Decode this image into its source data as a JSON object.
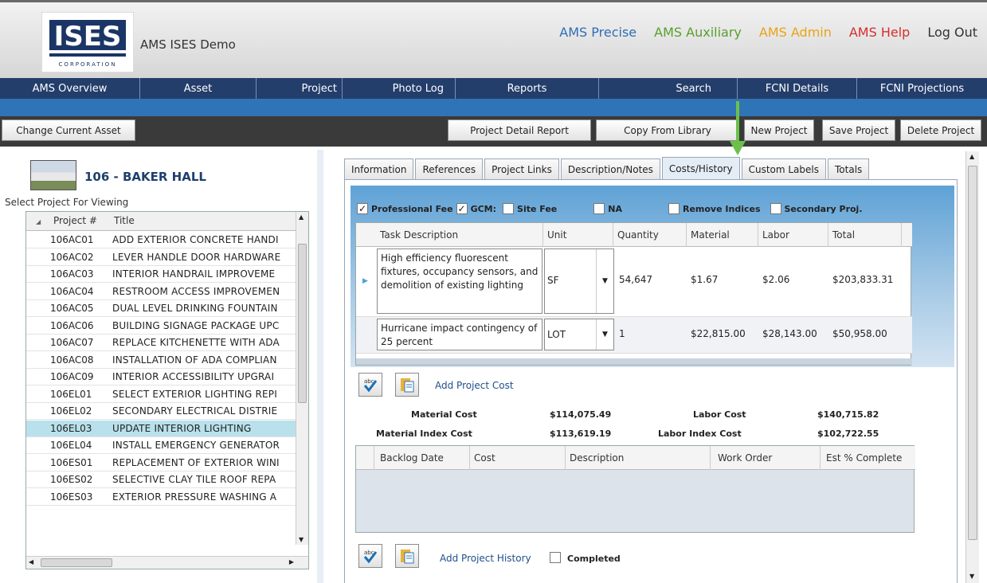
{
  "header": {
    "logo_text": "ISES",
    "logo_sub": "CORPORATION",
    "app_title": "AMS ISES Demo",
    "links": [
      {
        "label": "AMS Precise",
        "color": "#2f6db5"
      },
      {
        "label": "AMS Auxiliary",
        "color": "#5a9e2e"
      },
      {
        "label": "AMS Admin",
        "color": "#e8a316"
      },
      {
        "label": "AMS Help",
        "color": "#d62d2d"
      },
      {
        "label": "Log Out",
        "color": "#333333"
      }
    ]
  },
  "nav": {
    "items": [
      "AMS Overview",
      "Asset",
      "Project",
      "Photo Log",
      "Reports",
      "Search",
      "FCNI Details",
      "FCNI Projections"
    ]
  },
  "toolbar": {
    "change_asset": "Change Current Asset",
    "project_detail_report": "Project Detail Report",
    "copy_from_library": "Copy From Library",
    "new_project": "New Project",
    "save_project": "Save Project",
    "delete_project": "Delete Project"
  },
  "asset": {
    "title": "106 - BAKER HALL",
    "select_label": "Select Project For Viewing"
  },
  "project_grid": {
    "headers": [
      "Project #",
      "Title"
    ],
    "rows": [
      {
        "num": "106AC01",
        "title": "ADD EXTERIOR CONCRETE HANDI"
      },
      {
        "num": "106AC02",
        "title": "LEVER HANDLE DOOR HARDWARE"
      },
      {
        "num": "106AC03",
        "title": "INTERIOR HANDRAIL IMPROVEME"
      },
      {
        "num": "106AC04",
        "title": "RESTROOM ACCESS IMPROVEMEN"
      },
      {
        "num": "106AC05",
        "title": "DUAL LEVEL DRINKING FOUNTAIN"
      },
      {
        "num": "106AC06",
        "title": "BUILDING SIGNAGE PACKAGE UPC"
      },
      {
        "num": "106AC07",
        "title": "REPLACE KITCHENETTE WITH ADA"
      },
      {
        "num": "106AC08",
        "title": "INSTALLATION OF ADA COMPLIAN"
      },
      {
        "num": "106AC09",
        "title": "INTERIOR ACCESSIBILITY UPGRAI"
      },
      {
        "num": "106EL01",
        "title": "SELECT EXTERIOR LIGHTING REPI"
      },
      {
        "num": "106EL02",
        "title": "SECONDARY ELECTRICAL DISTRIE"
      },
      {
        "num": "106EL03",
        "title": "UPDATE INTERIOR LIGHTING"
      },
      {
        "num": "106EL04",
        "title": "INSTALL EMERGENCY GENERATOR"
      },
      {
        "num": "106ES01",
        "title": "REPLACEMENT OF EXTERIOR WINI"
      },
      {
        "num": "106ES02",
        "title": "SELECTIVE CLAY TILE ROOF REPA"
      },
      {
        "num": "106ES03",
        "title": "EXTERIOR PRESSURE WASHING A"
      }
    ]
  },
  "tabs": [
    "Information",
    "References",
    "Project Links",
    "Description/Notes",
    "Costs/History",
    "Custom Labels",
    "Totals"
  ],
  "checks": {
    "professional_fee": "Professional Fee",
    "gcm": "GCM:",
    "site_fee": "Site Fee",
    "na": "NA",
    "remove_indices": "Remove Indices",
    "secondary_proj": "Secondary Proj.",
    "check_mark": "✓"
  },
  "cost_table": {
    "headers": [
      "Task Description",
      "Unit",
      "Quantity",
      "Material",
      "Labor",
      "Total"
    ],
    "rows": [
      {
        "desc": "High efficiency fluorescent fixtures, occupancy sensors, and demolition of existing lighting",
        "unit": "SF",
        "qty": "54,647",
        "material": "$1.67",
        "labor": "$2.06",
        "total": "$203,833.31"
      },
      {
        "desc": "Hurricane impact contingency of 25 percent",
        "unit": "LOT",
        "qty": "1",
        "material": "$22,815.00",
        "labor": "$28,143.00",
        "total": "$50,958.00"
      }
    ]
  },
  "add_project_cost": "Add Project Cost",
  "summary": {
    "material_cost_label": "Material Cost",
    "material_cost": "$114,075.49",
    "labor_cost_label": "Labor Cost",
    "labor_cost": "$140,715.82",
    "material_index_label": "Material Index Cost",
    "material_index": "$113,619.19",
    "labor_index_label": "Labor Index Cost",
    "labor_index": "$102,722.55"
  },
  "history_table": {
    "headers": [
      "Backlog Date",
      "Cost",
      "Description",
      "Work Order",
      "Est % Complete"
    ]
  },
  "add_project_history": "Add Project History",
  "completed": "Completed"
}
